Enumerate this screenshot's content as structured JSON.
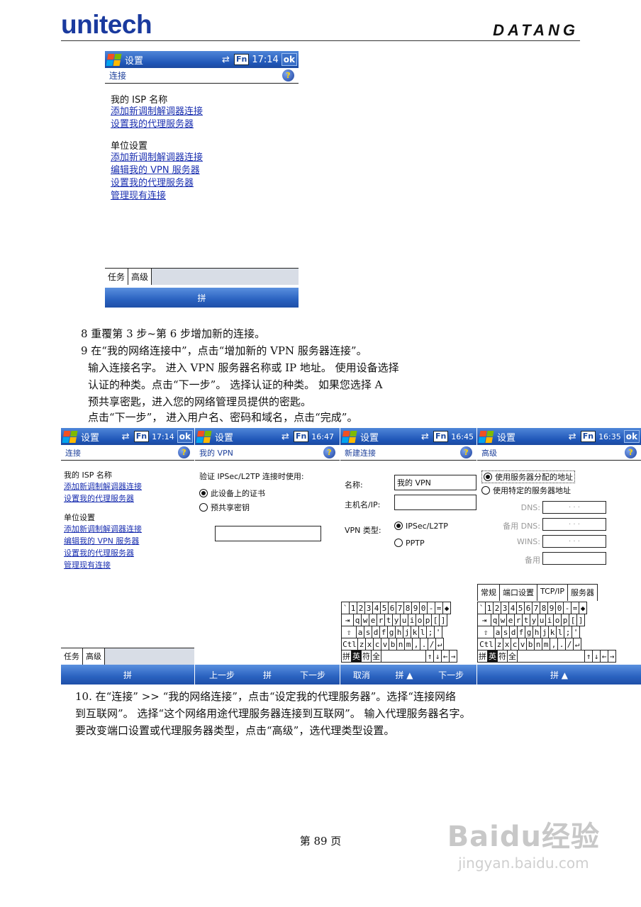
{
  "header": {
    "brand_left": "unitech",
    "brand_right": "DATANG"
  },
  "screens": {
    "top": {
      "title": "设置",
      "time": "17:14",
      "ok": "ok",
      "fn": "Fn",
      "net": "⇄",
      "help": "?",
      "page_title": "连接",
      "sections": [
        {
          "title": "我的 ISP 名称",
          "links": [
            "添加新调制解调器连接",
            "设置我的代理服务器"
          ]
        },
        {
          "title": "单位设置",
          "links": [
            "添加新调制解调器连接",
            "编辑我的 VPN 服务器",
            "设置我的代理服务器",
            "管理现有连接"
          ]
        }
      ],
      "tabs": [
        "任务",
        "高级"
      ],
      "menu": "拼"
    },
    "s1": {
      "title": "设置",
      "time": "17:14",
      "ok": "ok",
      "fn": "Fn",
      "net": "⇄",
      "help": "?",
      "page_title": "连接",
      "sections": [
        {
          "title": "我的 ISP 名称",
          "links": [
            "添加新调制解调器连接",
            "设置我的代理服务器"
          ]
        },
        {
          "title": "单位设置",
          "links": [
            "添加新调制解调器连接",
            "编辑我的 VPN 服务器",
            "设置我的代理服务器",
            "管理现有连接"
          ]
        }
      ],
      "tabs": [
        "任务",
        "高级"
      ],
      "menu": "拼"
    },
    "s2": {
      "title": "设置",
      "time": "16:47",
      "fn": "Fn",
      "net": "⇄",
      "help": "?",
      "page_title": "我的 VPN",
      "label": "验证 IPSec/L2TP 连接时使用:",
      "options": [
        "此设备上的证书",
        "预共享密钥"
      ],
      "menu": [
        "上一步",
        "拼",
        "下一步"
      ]
    },
    "s3": {
      "title": "设置",
      "time": "16:45",
      "fn": "Fn",
      "net": "⇄",
      "help": "?",
      "page_title": "新建连接",
      "name_label": "名称:",
      "name_value": "我的 VPN",
      "host_label": "主机名/IP:",
      "type_label": "VPN 类型:",
      "types": [
        "IPSec/L2TP",
        "PPTP"
      ],
      "menu": [
        "取消",
        "拼 ▲",
        "下一步"
      ]
    },
    "s4": {
      "title": "设置",
      "time": "16:35",
      "ok": "ok",
      "fn": "Fn",
      "net": "⇄",
      "help": "?",
      "page_title": "高级",
      "options": [
        "使用服务器分配的地址",
        "使用特定的服务器地址"
      ],
      "fields": [
        "DNS:",
        "备用 DNS:",
        "WINS:",
        "备用"
      ],
      "ip_placeholder": ". . .",
      "tabs": [
        "常规",
        "端口设置",
        "TCP/IP",
        "服务器"
      ],
      "menu": "拼 ▲"
    }
  },
  "keyboard": {
    "row1": [
      "`",
      "1",
      "2",
      "3",
      "4",
      "5",
      "6",
      "7",
      "8",
      "9",
      "0",
      "-",
      "=",
      "◆"
    ],
    "row2": [
      "⇥",
      "q",
      "w",
      "e",
      "r",
      "t",
      "y",
      "u",
      "i",
      "o",
      "p",
      "[",
      "]"
    ],
    "row3": [
      "⇧",
      "a",
      "s",
      "d",
      "f",
      "g",
      "h",
      "j",
      "k",
      "l",
      ";",
      "'"
    ],
    "row4": [
      "Ctl",
      "z",
      "x",
      "c",
      "v",
      "b",
      "n",
      "m",
      ",",
      ".",
      "/",
      "↵"
    ],
    "row5": [
      "拼",
      "英",
      "符",
      "全",
      "↑",
      "↓",
      "←",
      "→"
    ]
  },
  "body": {
    "step8": "8 重覆第 3 步~第 6 步增加新的连接。",
    "step9_l1": "9 在“我的网络连接中”，点击“增加新的 VPN 服务器连接”。",
    "step9_l2": "输入连接名字。 进入 VPN 服务器名称或 IP 地址。 使用设备选择",
    "step9_l3": "认证的种类。点击“下一步”。 选择认证的种类。 如果您选择 A",
    "step9_l4": "预共享密匙，进入您的网络管理员提供的密匙。",
    "step9_l5": "点击“下一步”， 进入用户名、密码和域名，点击“完成”。",
    "step10_l1": "10. 在“连接” >> “我的网络连接”，点击“设定我的代理服务器”。选择“连接网络",
    "step10_l2": "到互联网”。 选择“这个网络用途代理服务器连接到互联网”。 输入代理服务器名字。",
    "step10_l3": "要改变端口设置或代理服务器类型，点击“高级”，选代理类型设置。"
  },
  "footer": {
    "page_number": "第 89 页"
  },
  "watermark": {
    "text": "Baidu经验",
    "url": "jingyan.baidu.com"
  }
}
